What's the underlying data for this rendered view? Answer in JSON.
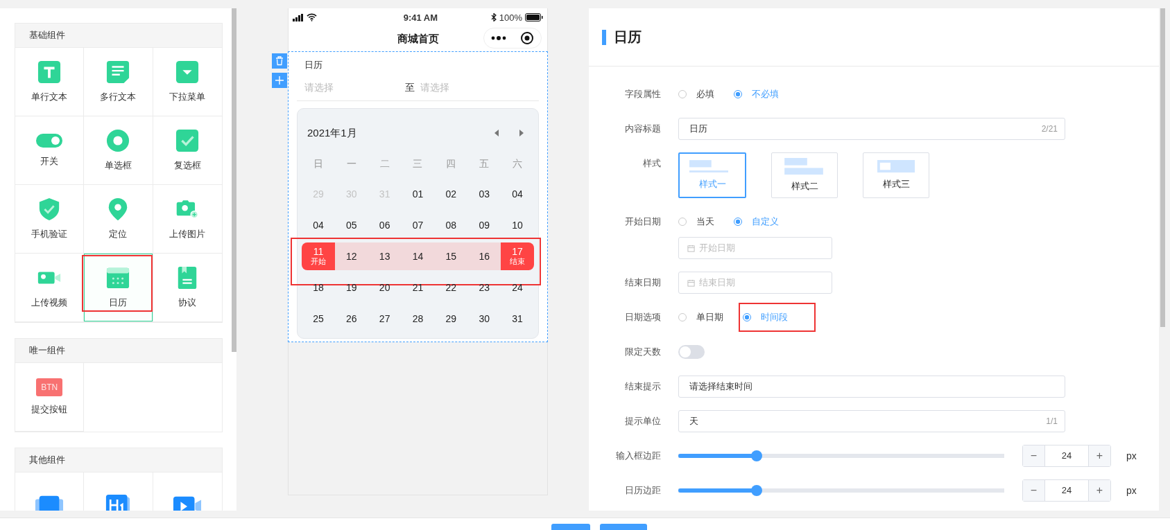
{
  "sidebar": {
    "groups": [
      {
        "title": "基础组件",
        "items": [
          {
            "kind": "text",
            "label": "单行文本",
            "selected": false,
            "highlighted": false
          },
          {
            "kind": "textarea",
            "label": "多行文本",
            "selected": false,
            "highlighted": false
          },
          {
            "kind": "dropdown",
            "label": "下拉菜单",
            "selected": false,
            "highlighted": false
          },
          {
            "kind": "switch",
            "label": "开关",
            "selected": false,
            "highlighted": false
          },
          {
            "kind": "radio",
            "label": "单选框",
            "selected": false,
            "highlighted": false
          },
          {
            "kind": "checkbox",
            "label": "复选框",
            "selected": false,
            "highlighted": false
          },
          {
            "kind": "shield",
            "label": "手机验证",
            "selected": false,
            "highlighted": false
          },
          {
            "kind": "pin",
            "label": "定位",
            "selected": false,
            "highlighted": false
          },
          {
            "kind": "camera",
            "label": "上传图片",
            "selected": false,
            "highlighted": false
          },
          {
            "kind": "video",
            "label": "上传视频",
            "selected": false,
            "highlighted": false
          },
          {
            "kind": "calendar",
            "label": "日历",
            "selected": true,
            "highlighted": true
          },
          {
            "kind": "document",
            "label": "协议",
            "selected": false,
            "highlighted": false
          }
        ]
      },
      {
        "title": "唯一组件",
        "items": [
          {
            "kind": "button",
            "badge": "BTN",
            "label": "提交按钮",
            "selected": false,
            "highlighted": false
          }
        ]
      },
      {
        "title": "其他组件",
        "items": [
          {
            "kind": "carousel",
            "selected": false,
            "highlighted": false
          },
          {
            "kind": "heading",
            "selected": false,
            "highlighted": false
          },
          {
            "kind": "video-play",
            "selected": false,
            "highlighted": false
          }
        ]
      }
    ]
  },
  "phone": {
    "status": {
      "time": "9:41 AM",
      "battery": "100%"
    },
    "title": "商城首页",
    "component": {
      "label": "日历",
      "start_placeholder": "请选择",
      "separator": "至",
      "end_placeholder": "请选择",
      "calendar": {
        "month": "2021年1月",
        "weekdays": [
          "日",
          "一",
          "二",
          "三",
          "四",
          "五",
          "六"
        ],
        "weeks": [
          {
            "highlighted": false,
            "days": [
              {
                "day": "29",
                "kind": "other"
              },
              {
                "day": "30",
                "kind": "other"
              },
              {
                "day": "31",
                "kind": "other"
              },
              {
                "day": "01",
                "kind": "normal"
              },
              {
                "day": "02",
                "kind": "normal"
              },
              {
                "day": "03",
                "kind": "normal"
              },
              {
                "day": "04",
                "kind": "normal"
              }
            ]
          },
          {
            "highlighted": false,
            "days": [
              {
                "day": "04",
                "kind": "normal"
              },
              {
                "day": "05",
                "kind": "normal"
              },
              {
                "day": "06",
                "kind": "normal"
              },
              {
                "day": "07",
                "kind": "normal"
              },
              {
                "day": "08",
                "kind": "normal"
              },
              {
                "day": "09",
                "kind": "normal"
              },
              {
                "day": "10",
                "kind": "normal"
              }
            ]
          },
          {
            "highlighted": true,
            "days": [
              {
                "day": "11",
                "kind": "start",
                "note": "开始"
              },
              {
                "day": "12",
                "kind": "range"
              },
              {
                "day": "13",
                "kind": "range"
              },
              {
                "day": "14",
                "kind": "range"
              },
              {
                "day": "15",
                "kind": "range"
              },
              {
                "day": "16",
                "kind": "range"
              },
              {
                "day": "17",
                "kind": "end",
                "note": "结束"
              }
            ]
          },
          {
            "highlighted": false,
            "days": [
              {
                "day": "18",
                "kind": "normal"
              },
              {
                "day": "19",
                "kind": "normal"
              },
              {
                "day": "20",
                "kind": "normal"
              },
              {
                "day": "21",
                "kind": "normal"
              },
              {
                "day": "22",
                "kind": "normal"
              },
              {
                "day": "23",
                "kind": "normal"
              },
              {
                "day": "24",
                "kind": "normal"
              }
            ]
          },
          {
            "highlighted": false,
            "days": [
              {
                "day": "25",
                "kind": "normal"
              },
              {
                "day": "26",
                "kind": "normal"
              },
              {
                "day": "27",
                "kind": "normal"
              },
              {
                "day": "28",
                "kind": "normal"
              },
              {
                "day": "29",
                "kind": "normal"
              },
              {
                "day": "30",
                "kind": "normal"
              },
              {
                "day": "31",
                "kind": "normal"
              }
            ]
          }
        ]
      }
    }
  },
  "settings": {
    "title": "日历",
    "fields": [
      {
        "kind": "radio",
        "label": "字段属性",
        "options": [
          {
            "label": "必填",
            "selected": false,
            "highlighted": false
          },
          {
            "label": "不必填",
            "selected": true,
            "highlighted": false
          }
        ]
      },
      {
        "kind": "text",
        "label": "内容标题",
        "value": "日历",
        "counter": "2/21"
      },
      {
        "kind": "styles",
        "label": "样式",
        "options": [
          {
            "kind": "line",
            "label": "样式一",
            "selected": true
          },
          {
            "kind": "block",
            "label": "样式二",
            "selected": false
          },
          {
            "kind": "inset",
            "label": "样式三",
            "selected": false
          }
        ]
      },
      {
        "kind": "radio",
        "label": "开始日期",
        "options": [
          {
            "label": "当天",
            "selected": false,
            "highlighted": false
          },
          {
            "label": "自定义",
            "selected": true,
            "highlighted": false
          }
        ],
        "date_placeholder": "开始日期"
      },
      {
        "kind": "date",
        "label": "结束日期",
        "placeholder": "结束日期"
      },
      {
        "kind": "radio",
        "label": "日期选项",
        "options": [
          {
            "label": "单日期",
            "selected": false,
            "highlighted": false
          },
          {
            "label": "时间段",
            "selected": true,
            "highlighted": true
          }
        ]
      },
      {
        "kind": "switch",
        "label": "限定天数",
        "on": false
      },
      {
        "kind": "text",
        "label": "结束提示",
        "value": "请选择结束时间"
      },
      {
        "kind": "text",
        "label": "提示单位",
        "value": "天",
        "counter": "1/1"
      },
      {
        "kind": "slider",
        "label": "输入框边距",
        "level": 0.24,
        "minus": "−",
        "value": "24",
        "plus": "+",
        "unit": "px"
      },
      {
        "kind": "slider",
        "label": "日历边距",
        "level": 0.24,
        "minus": "−",
        "value": "24",
        "plus": "+",
        "unit": "px"
      }
    ]
  },
  "footer": {
    "buttons": [
      {
        "kind": "primary"
      },
      {
        "kind": "primary"
      }
    ]
  }
}
